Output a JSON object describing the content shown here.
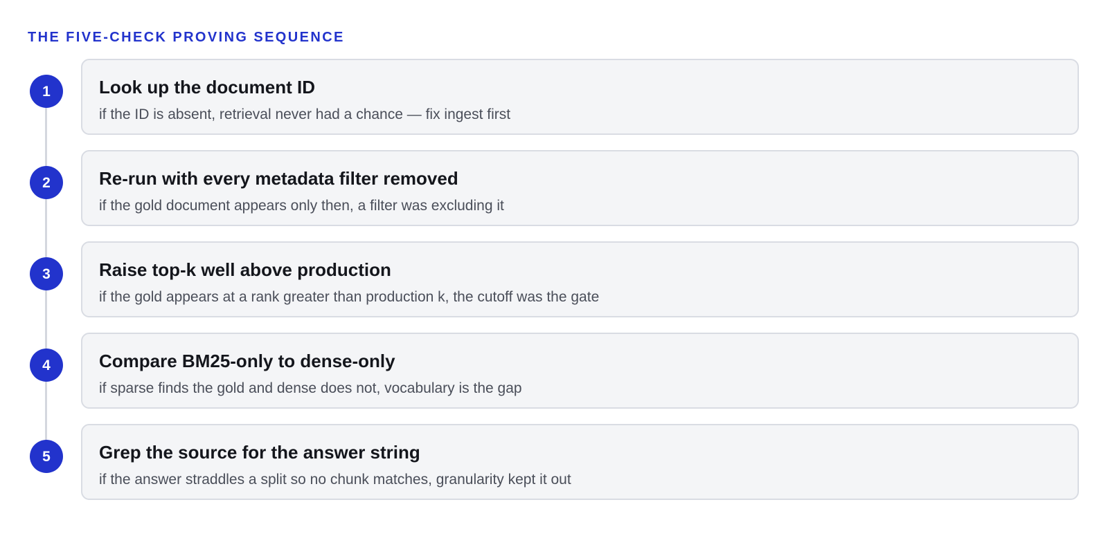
{
  "heading": "THE FIVE-CHECK PROVING SEQUENCE",
  "steps": [
    {
      "number": "1",
      "title": "Look up the document ID",
      "description": "if the ID is absent, retrieval never had a chance — fix ingest first"
    },
    {
      "number": "2",
      "title": "Re-run with every metadata filter removed",
      "description": "if the gold document appears only then, a filter was excluding it"
    },
    {
      "number": "3",
      "title": "Raise top-k well above production",
      "description": "if the gold appears at a rank greater than production k, the cutoff was the gate"
    },
    {
      "number": "4",
      "title": "Compare BM25-only to dense-only",
      "description": "if sparse finds the gold and dense does not, vocabulary is the gap"
    },
    {
      "number": "5",
      "title": "Grep the source for the answer string",
      "description": "if the answer straddles a split so no chunk matches, granularity kept it out"
    }
  ],
  "colors": {
    "accent": "#2233cc",
    "card_background": "#f4f5f7",
    "card_border": "#d9dce3",
    "connector": "#d4d7de",
    "title_text": "#14161c",
    "description_text": "#4a4e59"
  }
}
